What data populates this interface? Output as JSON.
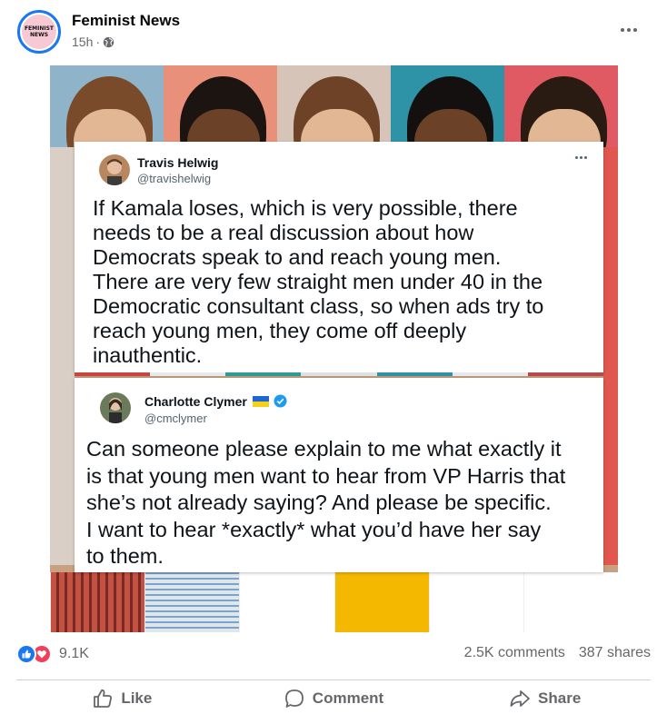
{
  "post": {
    "page_name": "Feminist News",
    "avatar_text_line1": "FEMINIST",
    "avatar_text_line2": "NEWS",
    "time": "15h",
    "separator": "·",
    "privacy_icon": "globe-icon",
    "more_icon": "more-horizontal-icon"
  },
  "image": {
    "tweets": [
      {
        "name": "Travis Helwig",
        "handle": "@travishelwig",
        "more_icon": "more-horizontal-icon",
        "text_lines": [
          "If Kamala loses, which is very possible, there",
          "needs to be a real discussion about how",
          "Democrats speak to and reach young men.",
          "There are very few straight men under 40 in the",
          "Democratic consultant class, so when ads try to",
          "reach young men, they come off deeply",
          "inauthentic."
        ]
      },
      {
        "name": "Charlotte Clymer",
        "handle": "@cmclymer",
        "flag_icon": "ukraine-flag-icon",
        "verified_icon": "verified-badge-icon",
        "text_lines": [
          "Can someone please explain to me what exactly it",
          "is that young men want to hear from VP Harris that",
          "she’s not already saying? And please be specific.",
          "I want to hear *exactly* what you’d have her say",
          "to them."
        ]
      }
    ],
    "colors": {
      "tile_top": [
        "#8fb3c9",
        "#e8907a",
        "#d6c4b8",
        "#2f93a8",
        "#e05a64"
      ],
      "tile_bottom": [
        "#c45243",
        "#dfe7ee",
        "#ffffff",
        "#f5b800",
        "#ffffff",
        "#ffffff"
      ],
      "stripe": [
        "#c6463f",
        "#e9e9e9",
        "#2a9d96",
        "#e0e0e0",
        "#2f93a8",
        "#e8e8e8",
        "#b7484b"
      ]
    }
  },
  "reactions": {
    "like_icon": "like-reaction-icon",
    "love_icon": "love-reaction-icon",
    "count": "9.1K",
    "comments": "2.5K comments",
    "shares": "387 shares"
  },
  "actions": {
    "like_label": "Like",
    "comment_label": "Comment",
    "share_label": "Share",
    "like_icon": "thumbs-up-icon",
    "comment_icon": "comment-bubble-icon",
    "share_icon": "share-arrow-icon"
  }
}
